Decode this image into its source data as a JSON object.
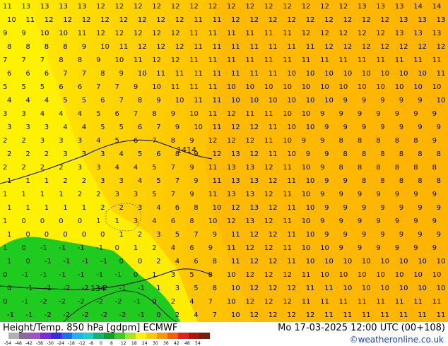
{
  "title_left": "Height/Temp. 850 hPa [gdpm] ECMWF",
  "title_right": "Mo 17-03-2025 12:00 UTC (00+108)",
  "credit": "©weatheronline.co.uk",
  "contour_labels": [
    "1414",
    "134"
  ],
  "colors": {
    "field_yellow": "#fff200",
    "field_gold": "#ffd200",
    "field_orange": "#ffb400",
    "field_green": "#1ecb1e",
    "text_dark": "#000000"
  },
  "color_scale": {
    "labels": [
      "-54",
      "-48",
      "-42",
      "-38",
      "-30",
      "-24",
      "-18",
      "-12",
      "-8",
      "0",
      "8",
      "12",
      "18",
      "24",
      "30",
      "36",
      "42",
      "48",
      "54"
    ],
    "colors": [
      "#b0b0b0",
      "#8a6a9e",
      "#a64fcf",
      "#7a2ae0",
      "#3a2ae8",
      "#1a6ef0",
      "#1ab4f0",
      "#14d2c8",
      "#10b46e",
      "#10a028",
      "#3ccf1e",
      "#a6e61e",
      "#fff200",
      "#ffc800",
      "#ff9600",
      "#ff5a00",
      "#e61e1e",
      "#b4140a",
      "#781e0a"
    ]
  },
  "temperature_grid": [
    [
      11,
      13,
      13,
      13,
      13,
      12,
      12,
      12,
      12,
      12,
      12,
      12,
      12,
      12,
      12,
      12,
      12,
      12,
      12,
      13,
      13,
      13,
      14,
      14
    ],
    [
      10,
      11,
      12,
      12,
      12,
      12,
      12,
      12,
      12,
      12,
      11,
      11,
      12,
      12,
      12,
      12,
      12,
      12,
      12,
      12,
      12,
      13,
      13,
      13
    ],
    [
      9,
      9,
      10,
      10,
      11,
      12,
      12,
      12,
      12,
      12,
      11,
      11,
      11,
      11,
      11,
      11,
      12,
      12,
      12,
      12,
      12,
      13,
      13,
      13
    ],
    [
      8,
      8,
      8,
      8,
      9,
      10,
      11,
      12,
      12,
      12,
      11,
      11,
      11,
      11,
      11,
      11,
      11,
      12,
      12,
      12,
      12,
      12,
      12,
      12
    ],
    [
      7,
      7,
      7,
      8,
      8,
      9,
      10,
      11,
      12,
      12,
      11,
      11,
      11,
      11,
      11,
      11,
      11,
      11,
      11,
      11,
      11,
      11,
      11,
      11
    ],
    [
      6,
      6,
      6,
      7,
      7,
      8,
      9,
      10,
      11,
      11,
      11,
      11,
      11,
      11,
      11,
      10,
      10,
      10,
      10,
      10,
      10,
      10,
      10,
      11
    ],
    [
      5,
      5,
      5,
      6,
      6,
      7,
      7,
      9,
      10,
      11,
      11,
      11,
      10,
      10,
      10,
      10,
      10,
      10,
      10,
      10,
      10,
      10,
      10,
      10
    ],
    [
      4,
      4,
      4,
      5,
      5,
      6,
      7,
      8,
      9,
      10,
      11,
      11,
      10,
      10,
      10,
      10,
      10,
      10,
      9,
      9,
      9,
      9,
      9,
      10
    ],
    [
      3,
      3,
      4,
      4,
      4,
      5,
      6,
      7,
      8,
      9,
      10,
      11,
      12,
      11,
      11,
      10,
      10,
      9,
      9,
      9,
      9,
      9,
      9,
      9
    ],
    [
      3,
      3,
      3,
      4,
      4,
      5,
      5,
      6,
      7,
      9,
      10,
      11,
      12,
      12,
      11,
      10,
      10,
      9,
      9,
      9,
      9,
      9,
      9,
      9
    ],
    [
      2,
      2,
      3,
      3,
      3,
      4,
      5,
      6,
      7,
      8,
      9,
      12,
      12,
      12,
      11,
      10,
      9,
      9,
      8,
      8,
      8,
      8,
      8,
      9
    ],
    [
      2,
      2,
      2,
      3,
      3,
      3,
      4,
      5,
      6,
      8,
      9,
      12,
      13,
      12,
      11,
      10,
      9,
      9,
      8,
      8,
      8,
      8,
      8,
      8
    ],
    [
      2,
      2,
      2,
      2,
      3,
      3,
      4,
      4,
      5,
      7,
      9,
      11,
      13,
      13,
      12,
      11,
      10,
      9,
      8,
      8,
      8,
      8,
      8,
      8
    ],
    [
      1,
      1,
      1,
      2,
      2,
      3,
      3,
      4,
      5,
      7,
      9,
      11,
      13,
      13,
      12,
      11,
      10,
      9,
      9,
      8,
      8,
      8,
      8,
      8
    ],
    [
      1,
      1,
      1,
      1,
      2,
      2,
      3,
      3,
      5,
      7,
      9,
      11,
      13,
      13,
      12,
      11,
      10,
      9,
      9,
      9,
      9,
      9,
      9,
      9
    ],
    [
      1,
      1,
      1,
      1,
      1,
      2,
      2,
      3,
      4,
      6,
      8,
      10,
      12,
      13,
      12,
      11,
      10,
      9,
      9,
      9,
      9,
      9,
      9,
      9
    ],
    [
      1,
      0,
      0,
      0,
      0,
      1,
      1,
      3,
      4,
      6,
      8,
      10,
      12,
      13,
      12,
      11,
      10,
      9,
      9,
      9,
      9,
      9,
      9,
      9
    ],
    [
      1,
      0,
      0,
      0,
      0,
      0,
      1,
      2,
      3,
      5,
      7,
      9,
      11,
      12,
      12,
      11,
      10,
      9,
      9,
      9,
      9,
      9,
      9,
      9
    ],
    [
      1,
      0,
      -1,
      -1,
      -1,
      -1,
      0,
      1,
      2,
      4,
      6,
      9,
      11,
      12,
      12,
      11,
      10,
      10,
      9,
      9,
      9,
      9,
      9,
      9
    ],
    [
      1,
      0,
      -1,
      -1,
      -1,
      -1,
      0,
      0,
      2,
      4,
      6,
      8,
      11,
      12,
      12,
      11,
      10,
      10,
      10,
      10,
      10,
      10,
      10,
      10
    ],
    [
      0,
      -1,
      -1,
      -1,
      -1,
      -1,
      -1,
      0,
      1,
      3,
      5,
      8,
      10,
      12,
      12,
      12,
      11,
      10,
      10,
      10,
      10,
      10,
      10,
      10
    ],
    [
      0,
      -1,
      -1,
      -2,
      -2,
      -2,
      -1,
      -1,
      1,
      3,
      5,
      8,
      10,
      12,
      12,
      12,
      11,
      11,
      10,
      10,
      10,
      10,
      10,
      10
    ],
    [
      0,
      -1,
      -2,
      -2,
      -2,
      -2,
      -2,
      -1,
      0,
      2,
      4,
      7,
      10,
      12,
      12,
      12,
      11,
      11,
      11,
      11,
      11,
      11,
      11,
      11
    ],
    [
      -1,
      -1,
      -2,
      -2,
      -2,
      -2,
      -2,
      -1,
      0,
      2,
      4,
      7,
      10,
      12,
      12,
      12,
      12,
      11,
      11,
      11,
      11,
      11,
      11,
      11
    ]
  ]
}
